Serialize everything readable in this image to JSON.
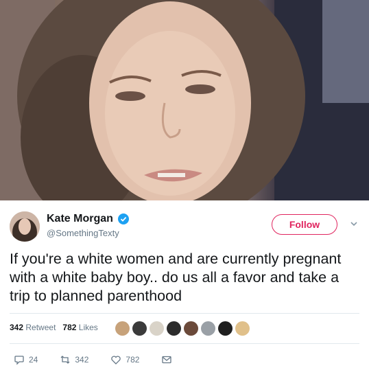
{
  "photo": {
    "description_icon": "selfie-photo"
  },
  "tweet": {
    "display_name": "Kate Morgan",
    "handle": "@SomethingTexty",
    "follow_label": "Follow",
    "text": "If you're a white women and are currently pregnant with a white baby boy.. do us all a favor and take a trip to planned parenthood",
    "retweets_count": "342",
    "retweets_label": "Retweet",
    "likes_count": "782",
    "likes_label": "Likes",
    "reply_count": "24",
    "retweet_action_count": "342",
    "like_action_count": "782"
  },
  "colors": {
    "follow_accent": "#e0245e",
    "verified": "#1da1f2",
    "muted": "#657786"
  },
  "liker_avatars": [
    "avatar-1",
    "avatar-2",
    "avatar-3",
    "avatar-4",
    "avatar-5",
    "avatar-6",
    "avatar-7",
    "avatar-8"
  ]
}
